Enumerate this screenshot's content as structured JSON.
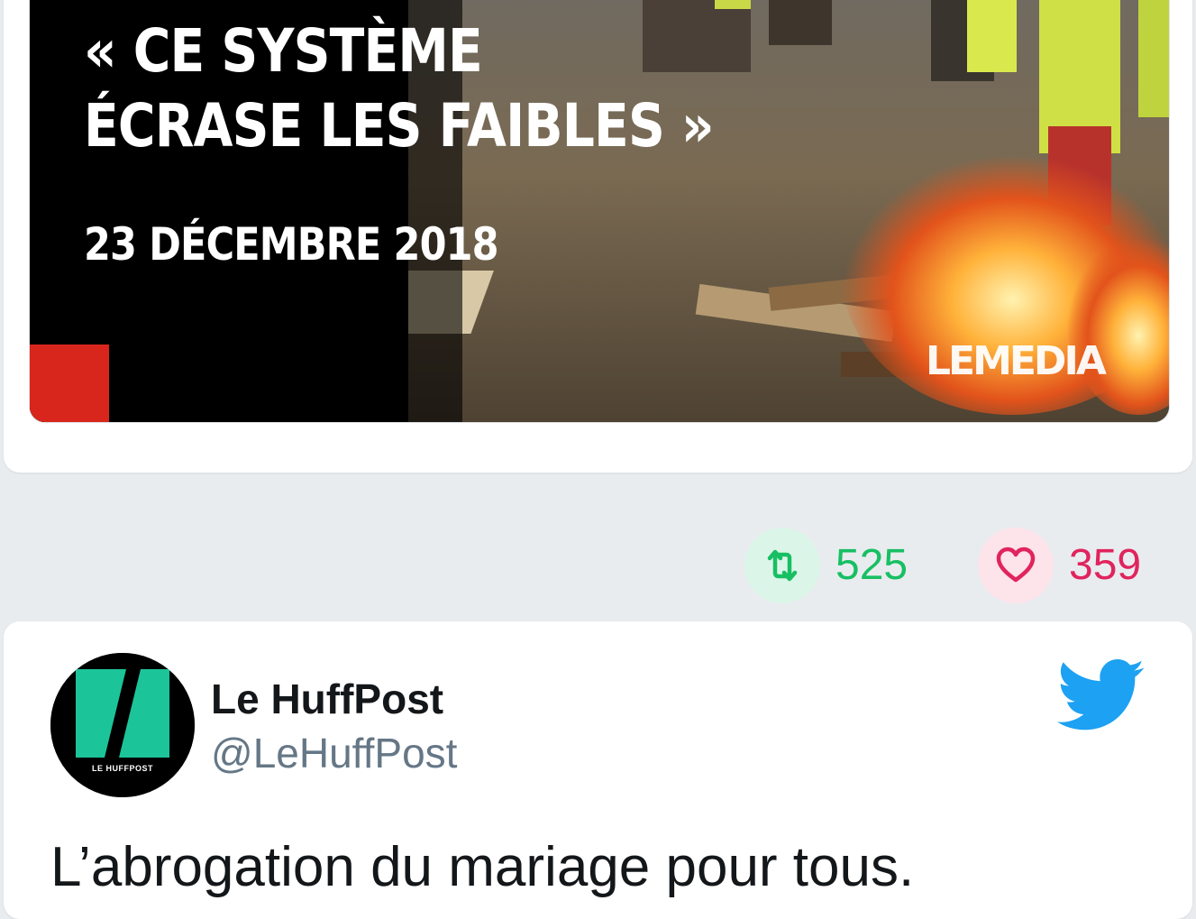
{
  "top_tweet": {
    "media": {
      "headline_line1": "« CE SYSTÈME",
      "headline_line2": "ÉCRASE LES FAIBLES »",
      "date": "23 DÉCEMBRE 2018",
      "brand": "LEMEDIA"
    },
    "actions": {
      "retweets": "525",
      "likes": "359"
    }
  },
  "bottom_tweet": {
    "author": {
      "display_name": "Le HuffPost",
      "handle": "@LeHuffPost",
      "avatar_caption": "LE HUFFPOST"
    },
    "text": "L’abrogation du mariage pour tous."
  },
  "colors": {
    "retweet": "#17bf63",
    "like": "#e0245e",
    "twitter_blue": "#1da1f2",
    "huffpost_green": "#1cc49a"
  },
  "icons": {
    "retweet": "retweet-icon",
    "like": "heart-icon",
    "brand": "twitter-bird-icon"
  }
}
